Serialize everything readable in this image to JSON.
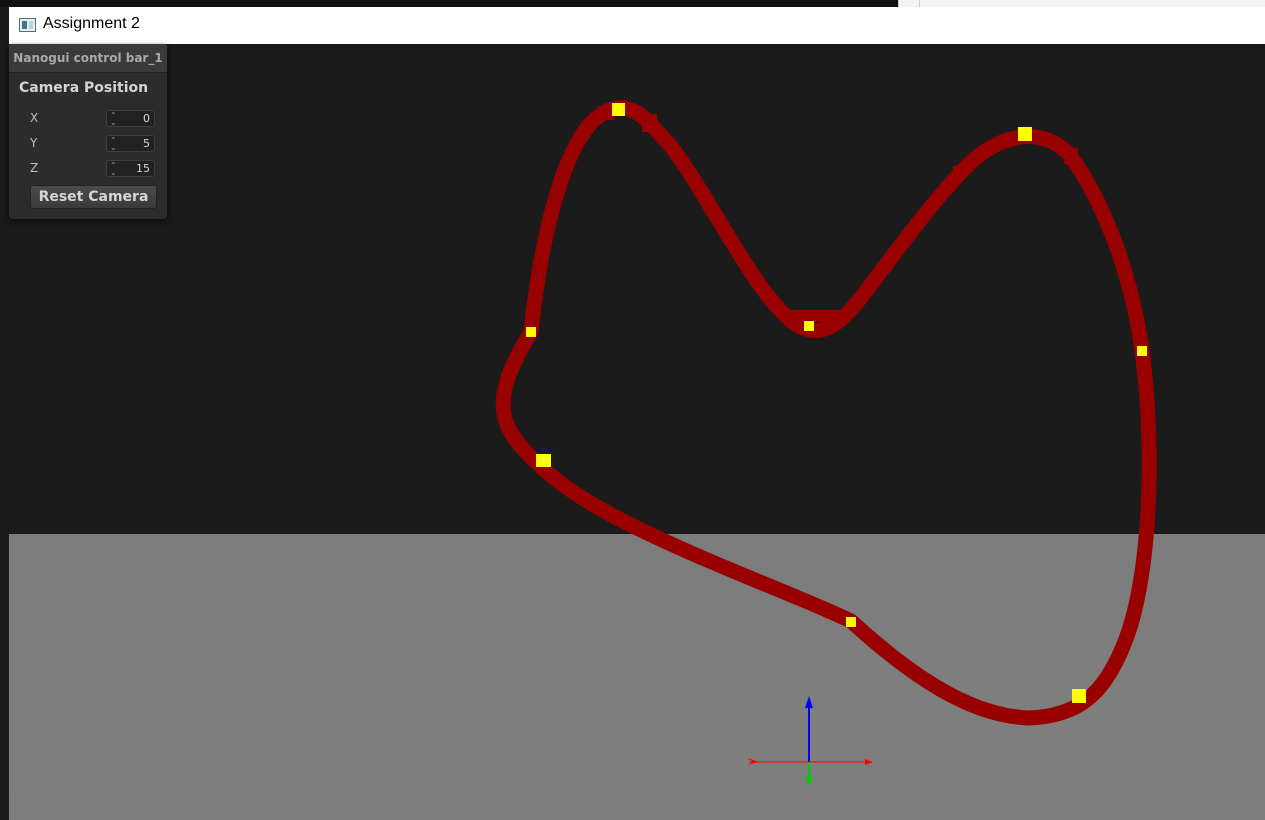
{
  "window": {
    "title": "Assignment 2",
    "icon": "app-window-icon"
  },
  "control_panel": {
    "header": "Nanogui control bar_1",
    "group_label": "Camera Position",
    "fields": [
      {
        "label": "X",
        "value": "0"
      },
      {
        "label": "Y",
        "value": "5"
      },
      {
        "label": "Z",
        "value": "15"
      }
    ],
    "reset_label": "Reset Camera"
  },
  "scene": {
    "sky_color": "#1b1b1b",
    "ground_color": "#7d7d7d",
    "track_color": "#990000",
    "control_point_color": "#ffff00",
    "axis_colors": {
      "x": "#ff0000",
      "y": "#0000ff",
      "z": "#00cc00"
    }
  }
}
